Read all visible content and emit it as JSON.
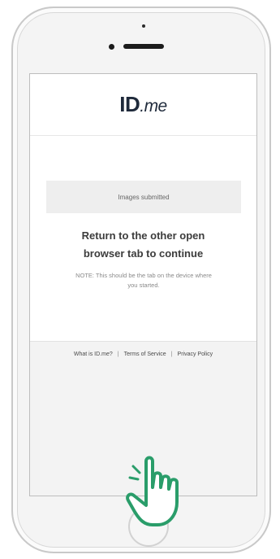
{
  "brand": {
    "logo_id": "ID",
    "logo_me": ".me"
  },
  "status_box": {
    "text": "Images submitted"
  },
  "headline": {
    "line1": "Return to the other open",
    "line2": "browser tab to continue"
  },
  "note": {
    "text": "NOTE: This should be the tab on the device where you started."
  },
  "footer": {
    "links": [
      "What is ID.me?",
      "Terms of Service",
      "Privacy Policy"
    ],
    "separator": "|"
  },
  "icons": {
    "hand": "pointing-hand-icon"
  },
  "colors": {
    "accent_green": "#2a9d6a",
    "logo_dark": "#1f2a3b"
  }
}
